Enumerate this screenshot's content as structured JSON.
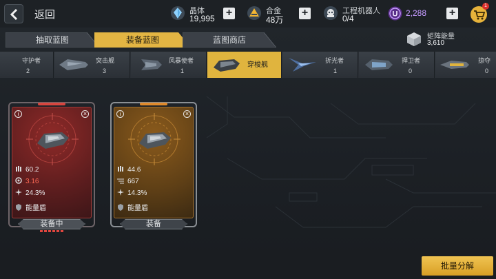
{
  "topbar": {
    "back_label": "返回",
    "resources": [
      {
        "label": "晶体",
        "value": "19,995",
        "icon": "crystal-icon"
      },
      {
        "label": "合金",
        "value": "48万",
        "icon": "alloy-icon"
      },
      {
        "label": "工程机器人",
        "value": "0/4",
        "icon": "robot-icon"
      },
      {
        "label": "",
        "value": "2,288",
        "icon": "u-currency-icon"
      }
    ],
    "cart_badge": "1"
  },
  "tabs": [
    {
      "label": "抽取蓝图",
      "active": false
    },
    {
      "label": "装备蓝图",
      "active": true
    },
    {
      "label": "蓝图商店",
      "active": false
    }
  ],
  "matrix": {
    "label": "矩阵能量",
    "value": "3,610"
  },
  "ship_types": [
    {
      "name": "守护者",
      "count": "2",
      "selected": false
    },
    {
      "name": "突击舰",
      "count": "3",
      "selected": false
    },
    {
      "name": "风暴使者",
      "count": "1",
      "selected": false
    },
    {
      "name": "穿梭舰",
      "count": "",
      "selected": true
    },
    {
      "name": "折光者",
      "count": "1",
      "selected": false
    },
    {
      "name": "捍卫者",
      "count": "0",
      "selected": false
    },
    {
      "name": "掠夺",
      "count": "0",
      "selected": false
    }
  ],
  "cards": [
    {
      "rarity": "red",
      "stats": {
        "attack": "60.2",
        "rate": "3.16",
        "crit": "24.3%",
        "ability": "能量盾"
      },
      "button": "装备中"
    },
    {
      "rarity": "orange",
      "stats": {
        "attack": "44.6",
        "rate": "667",
        "crit": "14.3%",
        "ability": "能量盾"
      },
      "button": "装备"
    }
  ],
  "batch_button": "批量分解",
  "colors": {
    "accent": "#e0b43e",
    "red_card": "#7a1e1e",
    "orange_card": "#7a4a14",
    "purple_currency": "#b57bff"
  }
}
